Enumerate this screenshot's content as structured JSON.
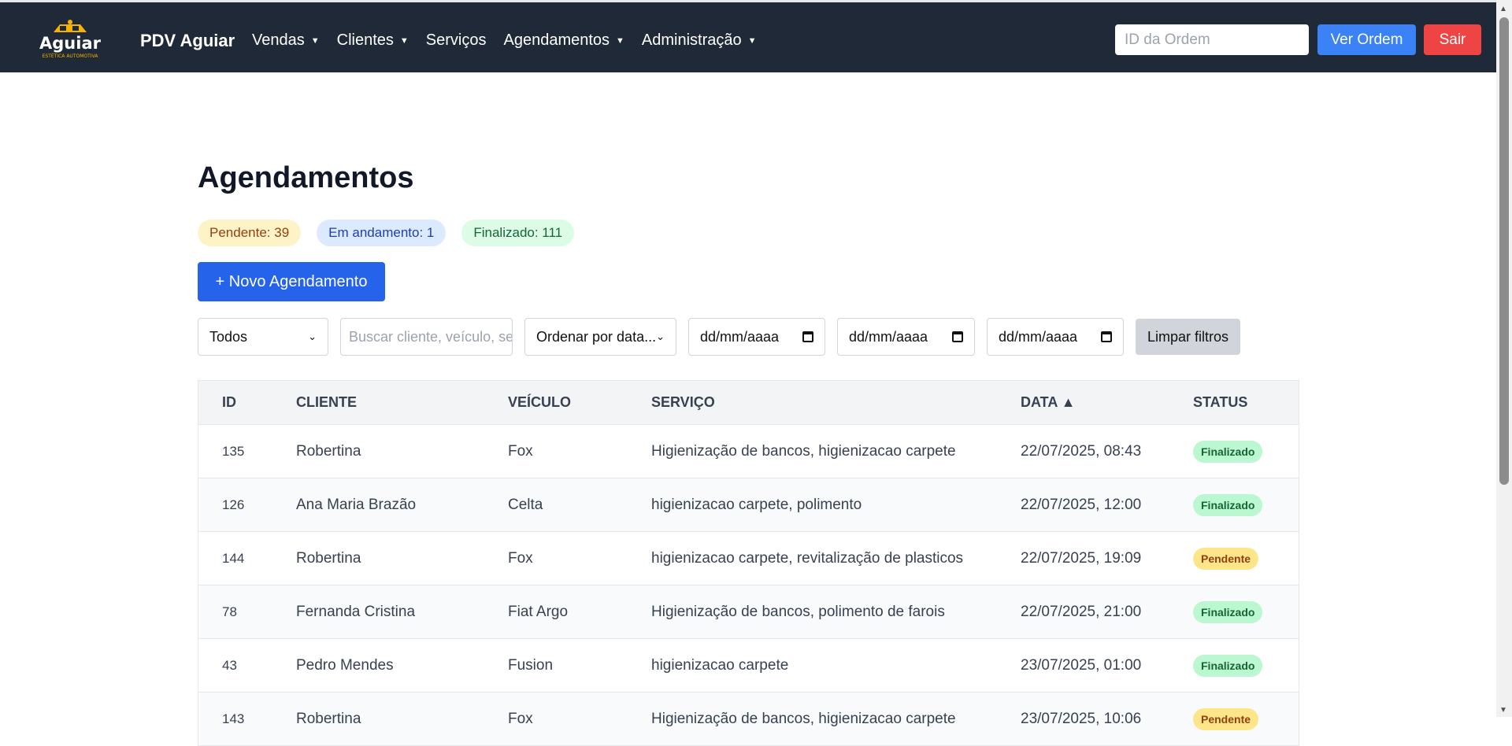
{
  "nav": {
    "logo_text": "Aguiar",
    "logo_subtext": "ESTÉTICA AUTOMOTIVA",
    "brand": "PDV Aguiar",
    "items": [
      {
        "label": "Vendas",
        "dropdown": true
      },
      {
        "label": "Clientes",
        "dropdown": true
      },
      {
        "label": "Serviços",
        "dropdown": false
      },
      {
        "label": "Agendamentos",
        "dropdown": true
      },
      {
        "label": "Administração",
        "dropdown": true
      }
    ],
    "order_input_placeholder": "ID da Ordem",
    "view_order_label": "Ver Ordem",
    "logout_label": "Sair"
  },
  "page": {
    "title": "Agendamentos",
    "counts": {
      "pendente": "Pendente: 39",
      "andamento": "Em andamento: 1",
      "finalizado": "Finalizado: 111"
    },
    "new_button": "+ Novo Agendamento"
  },
  "filters": {
    "status_select": "Todos",
    "search_placeholder": "Buscar cliente, veículo, serviço...",
    "sort_select": "Ordenar por data...",
    "date_placeholder": "dd/mm/aaaa",
    "clear_label": "Limpar filtros"
  },
  "table": {
    "headers": [
      "ID",
      "CLIENTE",
      "VEÍCULO",
      "SERVIÇO",
      "DATA ▲",
      "STATUS"
    ],
    "rows": [
      {
        "id": "135",
        "cliente": "Robertina",
        "veiculo": "Fox",
        "servico": "Higienização de bancos, higienizacao carpete",
        "data": "22/07/2025, 08:43",
        "status": "Finalizado"
      },
      {
        "id": "126",
        "cliente": "Ana Maria Brazão",
        "veiculo": "Celta",
        "servico": "higienizacao carpete, polimento",
        "data": "22/07/2025, 12:00",
        "status": "Finalizado"
      },
      {
        "id": "144",
        "cliente": "Robertina",
        "veiculo": "Fox",
        "servico": "higienizacao carpete, revitalização de plasticos",
        "data": "22/07/2025, 19:09",
        "status": "Pendente"
      },
      {
        "id": "78",
        "cliente": "Fernanda Cristina",
        "veiculo": "Fiat Argo",
        "servico": "Higienização de bancos, polimento de farois",
        "data": "22/07/2025, 21:00",
        "status": "Finalizado"
      },
      {
        "id": "43",
        "cliente": "Pedro Mendes",
        "veiculo": "Fusion",
        "servico": "higienizacao carpete",
        "data": "23/07/2025, 01:00",
        "status": "Finalizado"
      },
      {
        "id": "143",
        "cliente": "Robertina",
        "veiculo": "Fox",
        "servico": "Higienização de bancos, higienizacao carpete",
        "data": "23/07/2025, 10:06",
        "status": "Pendente"
      }
    ]
  }
}
